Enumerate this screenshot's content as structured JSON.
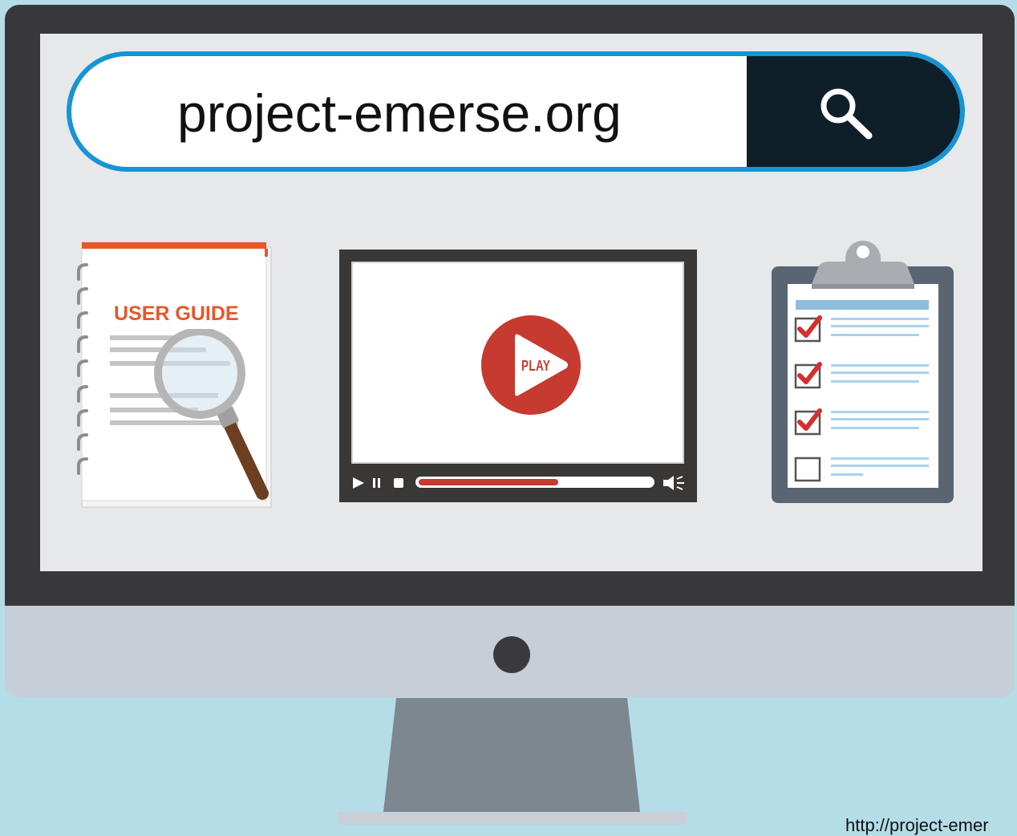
{
  "search": {
    "query": "project-emerse.org",
    "button_icon": "search-icon"
  },
  "user_guide": {
    "title": "USER GUIDE",
    "icon": "magnifying-glass-icon"
  },
  "video": {
    "play_label": "PLAY",
    "progress_percent": 60,
    "controls": [
      "play-icon",
      "pause-icon",
      "stop-icon",
      "volume-icon"
    ]
  },
  "checklist": {
    "items": [
      {
        "checked": true
      },
      {
        "checked": true
      },
      {
        "checked": true
      },
      {
        "checked": false
      }
    ]
  },
  "footer": {
    "url": "http://project-emer"
  },
  "colors": {
    "background": "#b4dde8",
    "accent_blue": "#1694d4",
    "search_button": "#0e1f2a",
    "play_red": "#c63a2f",
    "guide_orange": "#e8562a",
    "check_red": "#d62f2f"
  }
}
